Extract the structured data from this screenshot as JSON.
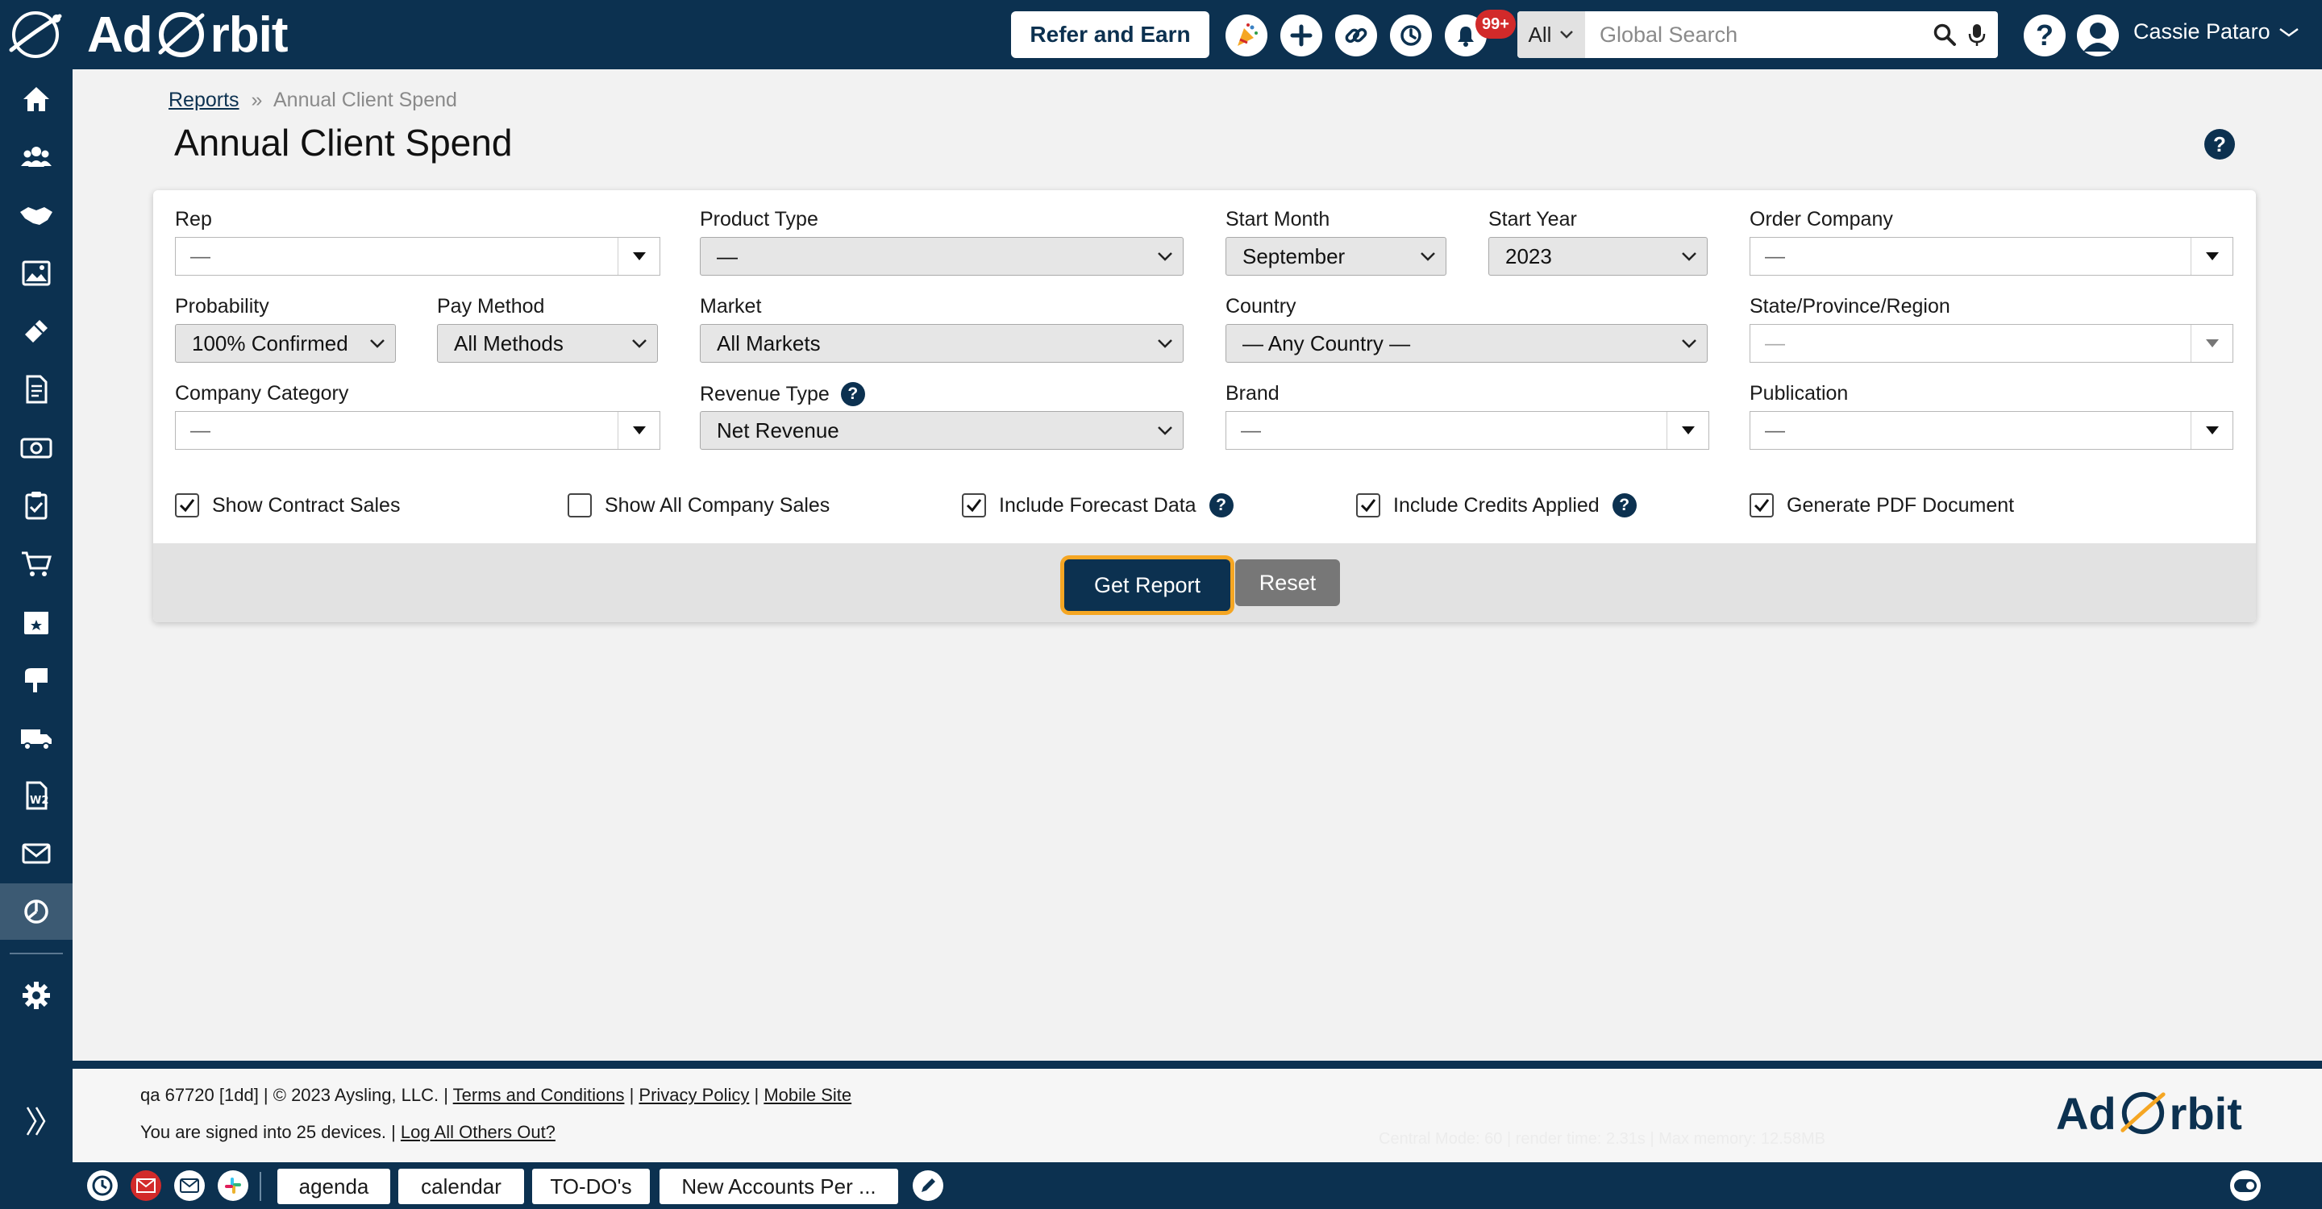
{
  "header": {
    "logo_text_left": "Ad",
    "logo_text_right": "rbit",
    "refer_label": "Refer and Earn",
    "notification_count": "99+",
    "search_scope": "All",
    "search_placeholder": "Global Search",
    "help_label": "?",
    "user_name": "Cassie Pataro",
    "accent_color": "#0c3150"
  },
  "breadcrumb": {
    "root": "Reports",
    "separator": "»",
    "current": "Annual Client Spend"
  },
  "page": {
    "title": "Annual Client Spend",
    "help": "?"
  },
  "filters": {
    "rep": {
      "label": "Rep",
      "value": "—"
    },
    "product_type": {
      "label": "Product Type",
      "value": "—"
    },
    "start_month": {
      "label": "Start Month",
      "value": "September"
    },
    "start_year": {
      "label": "Start Year",
      "value": "2023"
    },
    "order_company": {
      "label": "Order Company",
      "value": "—"
    },
    "probability": {
      "label": "Probability",
      "value": "100% Confirmed"
    },
    "pay_method": {
      "label": "Pay Method",
      "value": "All Methods"
    },
    "market": {
      "label": "Market",
      "value": "All Markets"
    },
    "country": {
      "label": "Country",
      "value": "— Any Country —"
    },
    "state": {
      "label": "State/Province/Region",
      "value": "—"
    },
    "company_category": {
      "label": "Company Category",
      "value": "—"
    },
    "revenue_type": {
      "label": "Revenue Type",
      "value": "Net Revenue"
    },
    "brand": {
      "label": "Brand",
      "value": "—"
    },
    "publication": {
      "label": "Publication",
      "value": "—"
    }
  },
  "options": [
    {
      "label": "Show Contract Sales",
      "checked": true,
      "help": false
    },
    {
      "label": "Show All Company Sales",
      "checked": false,
      "help": false
    },
    {
      "label": "Include Forecast Data",
      "checked": true,
      "help": true
    },
    {
      "label": "Include Credits Applied",
      "checked": true,
      "help": true
    },
    {
      "label": "Generate PDF Document",
      "checked": true,
      "help": false
    }
  ],
  "actions": {
    "get_report": "Get Report",
    "reset": "Reset"
  },
  "footer": {
    "version": "qa 67720 [1dd] | © 2023 Aysling, LLC. |",
    "terms": "Terms and Conditions",
    "privacy": "Privacy Policy",
    "mobile": "Mobile Site",
    "sep": "|",
    "devices": "You are signed into 25 devices. |",
    "logout": "Log All Others Out?",
    "faint": "Central Mode: 60 | render time: 2.31s | Max memory: 12.58MB"
  },
  "bottom_tabs": [
    "agenda",
    "calendar",
    "TO-DO's",
    "New Accounts Per ..."
  ]
}
